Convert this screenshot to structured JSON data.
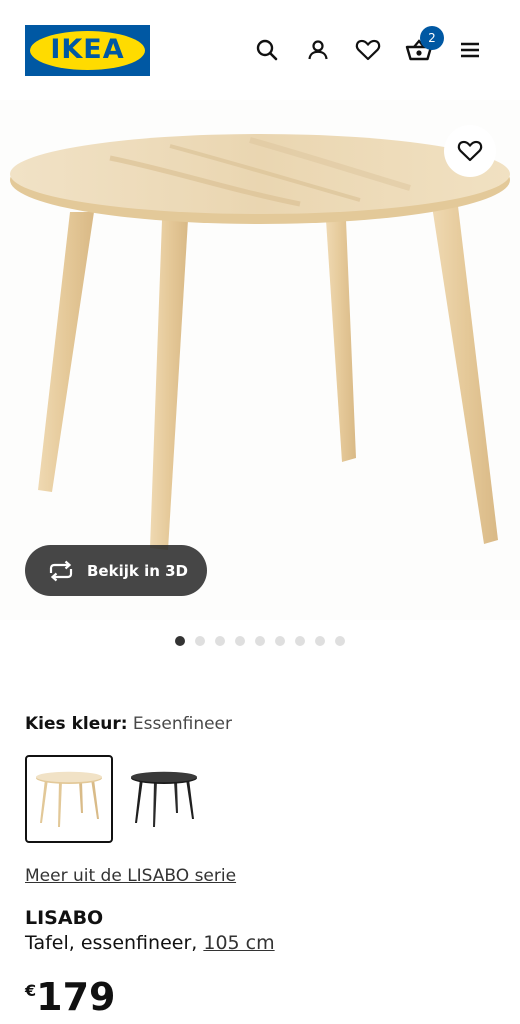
{
  "header": {
    "logo_text": "IKEA",
    "icons": [
      "search-icon",
      "user-icon",
      "heart-icon",
      "basket-icon",
      "menu-icon"
    ],
    "cart_count": "2",
    "brand_blue": "#0058a3",
    "brand_yellow": "#ffdb00"
  },
  "gallery": {
    "view_3d_label": "Bekijk in 3D",
    "image_count": 9,
    "active_index": 0
  },
  "color_picker": {
    "label": "Kies kleur:",
    "selected_value": "Essenfineer",
    "options": [
      "essenfineer",
      "zwart"
    ]
  },
  "product": {
    "series_link": "Meer uit de LISABO serie",
    "name": "LISABO",
    "description": "Tafel, essenfineer,",
    "size": "105 cm",
    "currency": "€",
    "price": "179"
  }
}
